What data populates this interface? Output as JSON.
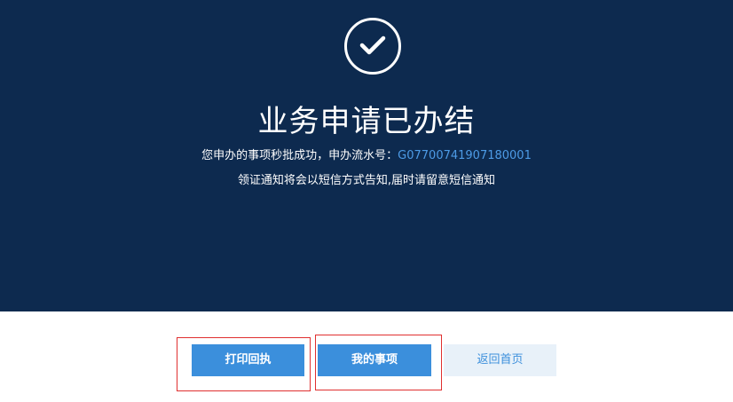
{
  "result": {
    "title": "业务申请已办结",
    "message_prefix": "您申办的事项秒批成功，申办流水号：",
    "serial_number": "G07700741907180001",
    "notice": "领证通知将会以短信方式告知,届时请留意短信通知"
  },
  "actions": {
    "print_label": "打印回执",
    "my_items_label": "我的事项",
    "home_label": "返回首页"
  },
  "colors": {
    "banner_bg": "#0d2a4f",
    "accent": "#3b8fdc",
    "serial_text": "#4d9be6",
    "highlight_border": "#e03030"
  },
  "icons": {
    "success": "check-circle-icon"
  }
}
